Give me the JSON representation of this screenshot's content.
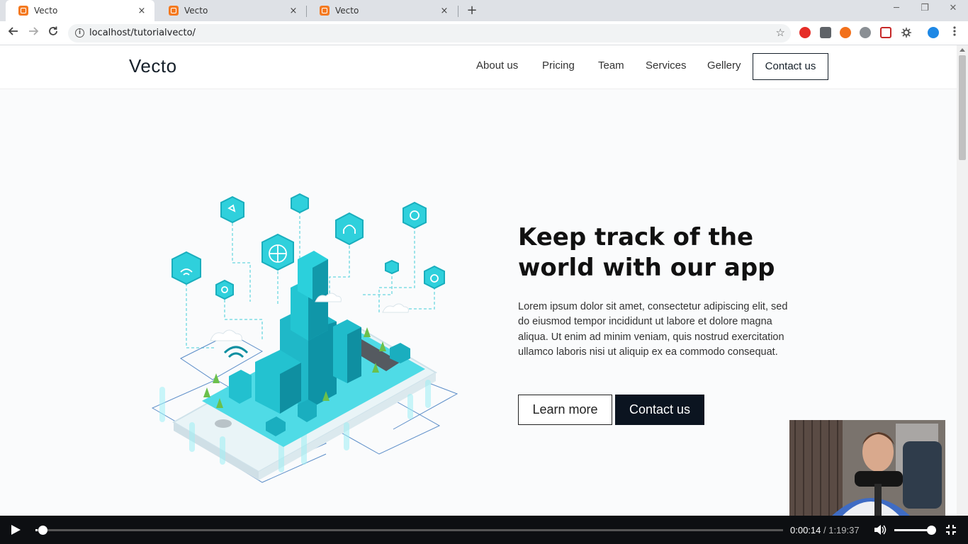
{
  "browser": {
    "tabs": [
      {
        "title": "Vecto",
        "close": "×"
      },
      {
        "title": "Vecto",
        "close": "×"
      },
      {
        "title": "Vecto",
        "close": "×"
      }
    ],
    "new_tab": "+",
    "url": "localhost/tutorialvecto/",
    "window_controls": [
      "─",
      "❐",
      "✕"
    ]
  },
  "site": {
    "logo": "Vecto",
    "nav": [
      "About us",
      "Pricing",
      "Team",
      "Services",
      "Gellery"
    ],
    "nav_cta": "Contact us"
  },
  "hero": {
    "title_line1": "Keep track of the",
    "title_line2": "world with our app",
    "paragraph": "Lorem ipsum dolor sit amet, consectetur adipiscing elit, sed do eiusmod tempor incididunt ut labore et dolore magna aliqua. Ut enim ad minim veniam, quis nostrud exercitation ullamco laboris nisi ut aliquip ex ea commodo consequat.",
    "btn_learn": "Learn more",
    "btn_contact": "Contact us"
  },
  "player": {
    "current_time": "0:00:14",
    "separator": " / ",
    "duration": "1:19:37",
    "progress": 0.003,
    "volume": 1.0
  },
  "colors": {
    "accent": "#2fd0dc",
    "dark": "#0b1420",
    "tab_favicon": "#f47a20"
  }
}
